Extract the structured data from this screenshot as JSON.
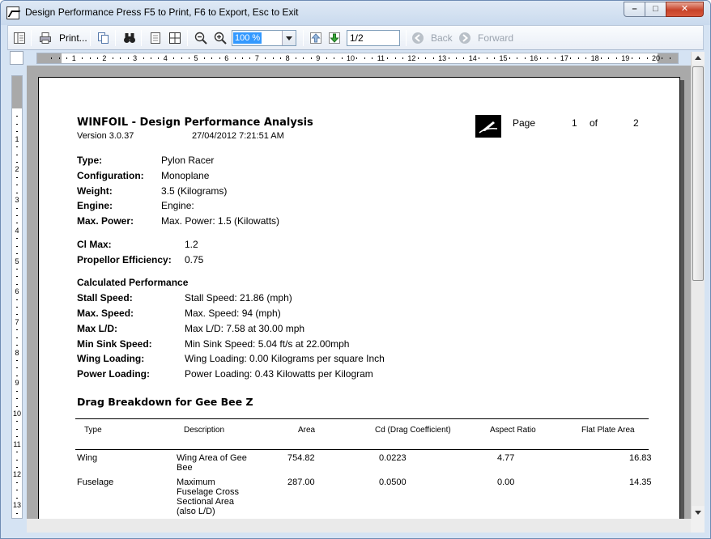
{
  "window": {
    "title": "Design Performance Press F5 to Print, F6 to Export, Esc to Exit",
    "min_glyph": "–",
    "max_glyph": "□",
    "close_glyph": "✕"
  },
  "toolbar": {
    "print_label": "Print...",
    "zoom_value": "100 %",
    "page_value": "1/2",
    "back_label": "Back",
    "forward_label": "Forward",
    "disabled_color": "#9aa3ae"
  },
  "ruler": {
    "h_labels": [
      "1",
      "2",
      "3",
      "4",
      "5",
      "6",
      "7",
      "8",
      "9",
      "10",
      "11",
      "12",
      "13",
      "14",
      "15",
      "16",
      "17",
      "18",
      "19",
      "20"
    ],
    "v_labels": [
      "1",
      "2",
      "3",
      "4",
      "5",
      "6",
      "7",
      "8",
      "9",
      "10",
      "11",
      "12",
      "13"
    ]
  },
  "report": {
    "title": "WINFOIL - Design Performance Analysis",
    "version": "Version 3.0.37",
    "datetime": "27/04/2012 7:21:51 AM",
    "page_label": "Page",
    "page_num": "1",
    "of_label": "of",
    "page_total": "2",
    "basic": [
      {
        "label": "Type:",
        "value": "Pylon Racer"
      },
      {
        "label": "Configuration:",
        "value": "Monoplane"
      },
      {
        "label": "Weight:",
        "value": "3.5 (Kilograms)"
      },
      {
        "label": "Engine:",
        "value": "Engine:"
      },
      {
        "label": "Max. Power:",
        "value": "Max. Power: 1.5 (Kilowatts)"
      }
    ],
    "coeffs": [
      {
        "label": "Cl Max:",
        "value": "1.2"
      },
      {
        "label": "Propellor Efficiency:",
        "value": "0.75"
      }
    ],
    "calc_heading": "Calculated Performance",
    "calc": [
      {
        "label": "Stall Speed:",
        "value": "Stall Speed: 21.86 (mph)"
      },
      {
        "label": "Max. Speed:",
        "value": "Max. Speed: 94 (mph)"
      },
      {
        "label": "Max L/D:",
        "value": "Max L/D: 7.58 at 30.00 mph"
      },
      {
        "label": "Min Sink Speed:",
        "value": "Min Sink Speed: 5.04 ft/s at 22.00mph"
      },
      {
        "label": "Wing Loading:",
        "value": "Wing Loading: 0.00 Kilograms per square Inch"
      },
      {
        "label": "Power Loading:",
        "value": "Power Loading: 0.43 Kilowatts per Kilogram"
      }
    ],
    "drag_heading": "Drag Breakdown for Gee Bee Z",
    "table_headers": [
      "Type",
      "Description",
      "Area",
      "Cd (Drag Coefficient)",
      "Aspect Ratio",
      "Flat Plate Area"
    ],
    "rows": [
      {
        "type": "Wing",
        "desc": [
          "Wing Area of Gee",
          "Bee"
        ],
        "area": "754.82",
        "cd": "0.0223",
        "ar": "4.77",
        "fpa": "16.83"
      },
      {
        "type": "Fuselage",
        "desc": [
          "Maximum",
          "Fuselage Cross",
          "Sectional Area",
          "(also L/D)"
        ],
        "area": "287.00",
        "cd": "0.0500",
        "ar": "0.00",
        "fpa": "14.35"
      }
    ]
  }
}
